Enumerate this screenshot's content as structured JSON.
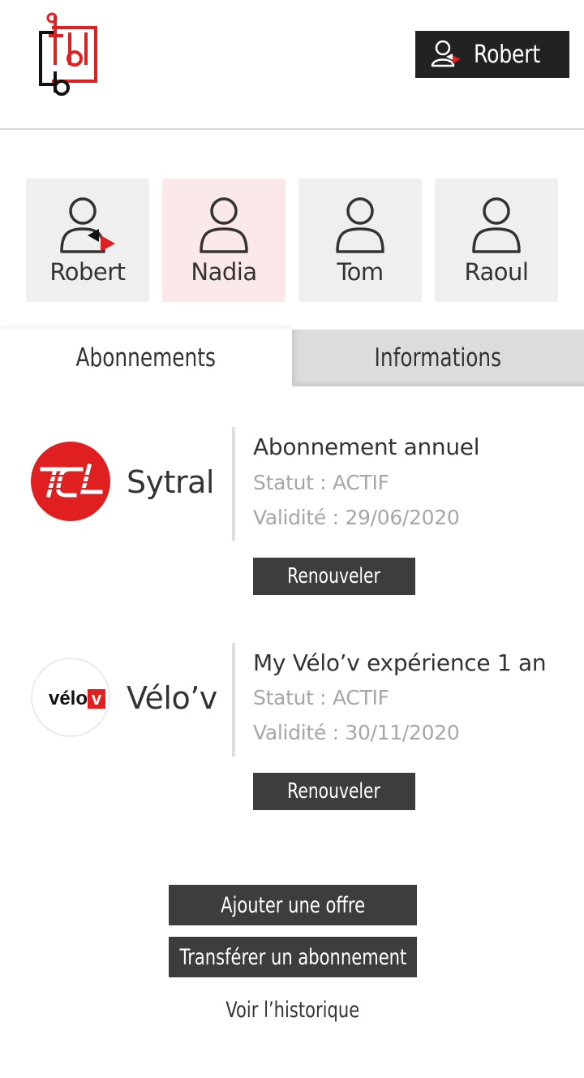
{
  "header": {
    "logo_icon": "tbl-logo",
    "user_button": {
      "label": "Robert",
      "icon": "user-switch-icon"
    }
  },
  "profiles": [
    {
      "name": "Robert",
      "icon": "user-switch-icon",
      "selected": false
    },
    {
      "name": "Nadia",
      "icon": "user-icon",
      "selected": true
    },
    {
      "name": "Tom",
      "icon": "user-icon",
      "selected": false
    },
    {
      "name": "Raoul",
      "icon": "user-icon",
      "selected": false
    }
  ],
  "tabs": [
    {
      "label": "Abonnements",
      "active": true
    },
    {
      "label": "Informations",
      "active": false
    }
  ],
  "subscriptions": [
    {
      "brand": "Sytral",
      "logo_text": "TCL",
      "title": "Abonnement annuel",
      "status": "Statut : ACTIF",
      "validity": "Validité : 29/06/2020",
      "button": "Renouveler"
    },
    {
      "brand": "Vélo’v",
      "logo_text": "vélo’v",
      "title": "My Vélo’v expérience 1 an",
      "status": "Statut : ACTIF",
      "validity": "Validité : 30/11/2020",
      "button": "Renouveler"
    }
  ],
  "actions": {
    "add_offer": "Ajouter une offre",
    "transfer": "Transférer un abonnement",
    "history": "Voir l’historique"
  },
  "colors": {
    "accent_red": "#e02020",
    "dark_button": "#3d3d3d",
    "header_button": "#222222",
    "selected_tile": "#fbe8e8",
    "tile": "#efefef"
  }
}
